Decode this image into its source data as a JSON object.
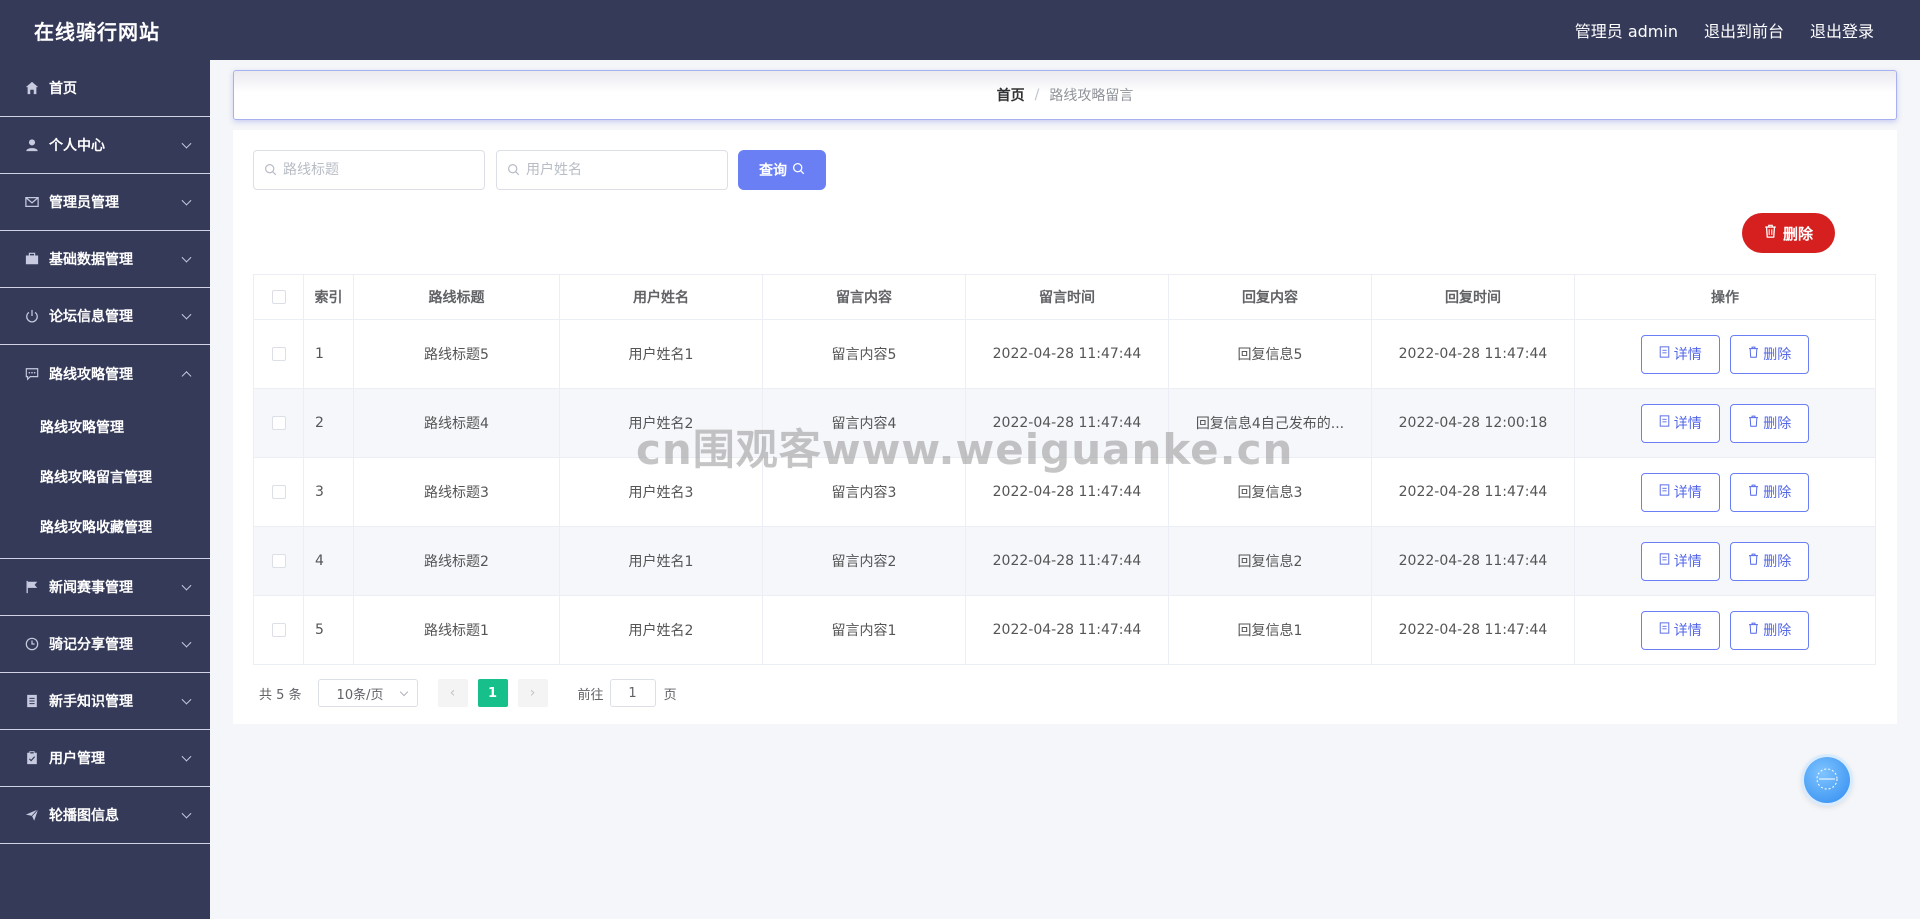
{
  "header": {
    "site_title": "在线骑行网站",
    "admin_label": "管理员 admin",
    "to_front": "退出到前台",
    "logout": "退出登录"
  },
  "sidebar": {
    "items": [
      {
        "label": "首页",
        "icon": "home-icon"
      },
      {
        "label": "个人中心",
        "icon": "user-icon"
      },
      {
        "label": "管理员管理",
        "icon": "mail-icon"
      },
      {
        "label": "基础数据管理",
        "icon": "briefcase-icon"
      },
      {
        "label": "论坛信息管理",
        "icon": "power-icon"
      },
      {
        "label": "路线攻略管理",
        "icon": "chat-icon"
      },
      {
        "label": "新闻赛事管理",
        "icon": "flag-icon"
      },
      {
        "label": "骑记分享管理",
        "icon": "clock-icon"
      },
      {
        "label": "新手知识管理",
        "icon": "document-icon"
      },
      {
        "label": "用户管理",
        "icon": "clipboard-icon"
      },
      {
        "label": "轮播图信息",
        "icon": "send-icon"
      }
    ],
    "submenu": [
      "路线攻略管理",
      "路线攻略留言管理",
      "路线攻略收藏管理"
    ]
  },
  "breadcrumb": {
    "home": "首页",
    "sep": "/",
    "current": "路线攻略留言"
  },
  "search": {
    "route_placeholder": "路线标题",
    "user_placeholder": "用户姓名",
    "query_label": "查询",
    "delete_label": "删除"
  },
  "table": {
    "headers": [
      "索引",
      "路线标题",
      "用户姓名",
      "留言内容",
      "留言时间",
      "回复内容",
      "回复时间",
      "操作"
    ],
    "rows": [
      {
        "idx": "1",
        "title": "路线标题5",
        "user": "用户姓名1",
        "content": "留言内容5",
        "time": "2022-04-28 11:47:44",
        "reply": "回复信息5",
        "reply_time": "2022-04-28 11:47:44"
      },
      {
        "idx": "2",
        "title": "路线标题4",
        "user": "用户姓名2",
        "content": "留言内容4",
        "time": "2022-04-28 11:47:44",
        "reply": "回复信息4自己发布的...",
        "reply_time": "2022-04-28 12:00:18"
      },
      {
        "idx": "3",
        "title": "路线标题3",
        "user": "用户姓名3",
        "content": "留言内容3",
        "time": "2022-04-28 11:47:44",
        "reply": "回复信息3",
        "reply_time": "2022-04-28 11:47:44"
      },
      {
        "idx": "4",
        "title": "路线标题2",
        "user": "用户姓名1",
        "content": "留言内容2",
        "time": "2022-04-28 11:47:44",
        "reply": "回复信息2",
        "reply_time": "2022-04-28 11:47:44"
      },
      {
        "idx": "5",
        "title": "路线标题1",
        "user": "用户姓名2",
        "content": "留言内容1",
        "time": "2022-04-28 11:47:44",
        "reply": "回复信息1",
        "reply_time": "2022-04-28 11:47:44"
      }
    ],
    "detail_label": "详情",
    "row_delete_label": "删除"
  },
  "pagination": {
    "total": "共 5 条",
    "page_size": "10条/页",
    "current_page": "1",
    "goto_prefix": "前往",
    "goto_value": "1",
    "goto_suffix": "页"
  },
  "watermark": "cn围观客www.weiguanke.cn",
  "colors": {
    "sidebar_bg": "#353a59",
    "accent": "#6b7ff5",
    "danger": "#d61f1f",
    "pager_active": "#17c08a"
  }
}
